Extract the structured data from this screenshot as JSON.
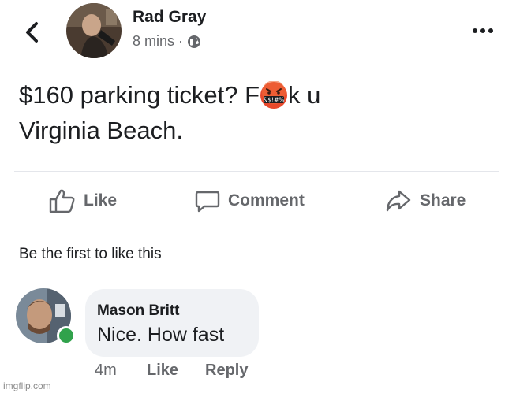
{
  "post": {
    "author": "Rad Gray",
    "time": "8 mins",
    "separator": "·",
    "privacy_icon": "globe-icon",
    "text_part1": "$160 parking ticket? F",
    "emoji_label": "&$!#%",
    "text_part2": "k u",
    "text_line2": "Virginia Beach."
  },
  "actions": {
    "like_label": "Like",
    "comment_label": "Comment",
    "share_label": "Share"
  },
  "reactions_summary": "Be the first to like this",
  "comment": {
    "author": "Mason Britt",
    "text": "Nice. How fast",
    "time": "4m",
    "like_label": "Like",
    "reply_label": "Reply"
  },
  "watermark": "imgflip.com",
  "colors": {
    "text_primary": "#1c1e21",
    "text_secondary": "#65676b",
    "bubble_bg": "#f0f2f5",
    "online_green": "#31a24c",
    "divider": "#e4e6eb"
  }
}
